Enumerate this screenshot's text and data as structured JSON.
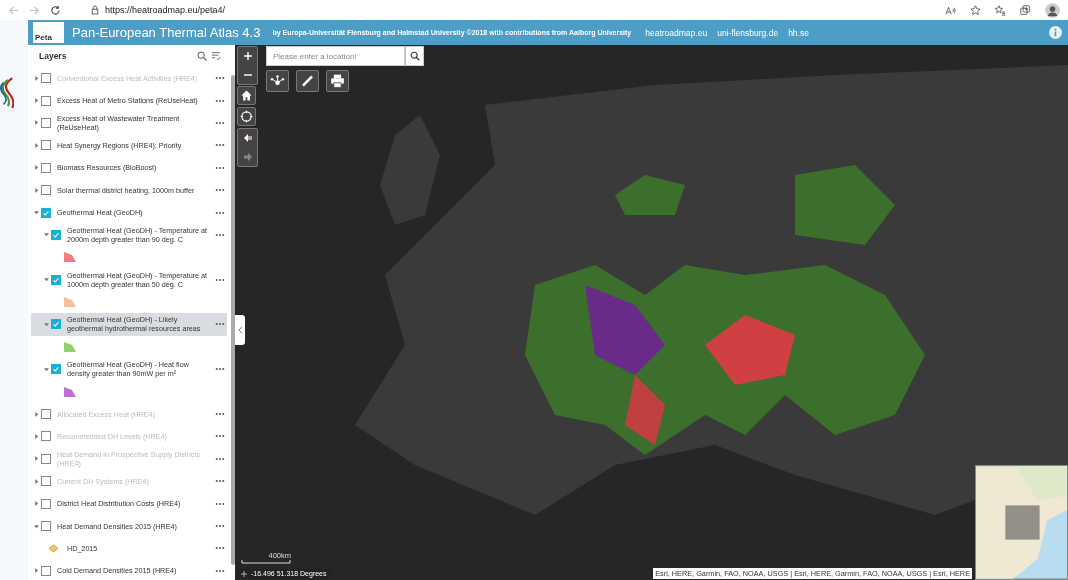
{
  "browser": {
    "url": "https://heatroadmap.eu/peta4/"
  },
  "header": {
    "logo_text": "Peta",
    "title": "Pan-European Thermal Atlas 4.3",
    "byline": "by Europa-Universität Flensburg and Halmstad University ©2018 with contributions from Aalborg University",
    "links": [
      "heatroadmap.eu",
      "uni-flensburg.de",
      "hh.se"
    ]
  },
  "sidebar": {
    "title": "Layers",
    "layers": [
      {
        "kind": "layer",
        "label": "Conventional Excess Heat Activities (HRE4)",
        "checked": false,
        "expanded": false,
        "disabled": true,
        "selected": false
      },
      {
        "kind": "layer",
        "label": "Excess Heat of Metro Stations (ReUseHeat)",
        "checked": false,
        "expanded": false,
        "disabled": false,
        "selected": false
      },
      {
        "kind": "layer",
        "label": "Excess Heat of Wastewater Treatment (ReUseHeat)",
        "checked": false,
        "expanded": false,
        "disabled": false,
        "selected": false
      },
      {
        "kind": "layer",
        "label": "Heat Synergy Regions (HRE4): Priority",
        "checked": false,
        "expanded": false,
        "disabled": false,
        "selected": false
      },
      {
        "kind": "layer",
        "label": "Biomass Resources (BioBoost)",
        "checked": false,
        "expanded": false,
        "disabled": false,
        "selected": false
      },
      {
        "kind": "layer",
        "label": "Solar thermal district heating, 1000m buffer",
        "checked": false,
        "expanded": false,
        "disabled": false,
        "selected": false
      },
      {
        "kind": "layer",
        "label": "Geothermal Heat (GeoDH)",
        "checked": true,
        "expanded": true,
        "disabled": false,
        "selected": false,
        "children": [
          {
            "kind": "layer",
            "label": "Geothermal Heat (GeoDH) - Temperature at 2000m depth greater than 90 deg. C",
            "checked": true,
            "expanded": true,
            "disabled": false,
            "selected": false,
            "children": [
              {
                "kind": "swatch",
                "color": "#f47c7c"
              }
            ]
          },
          {
            "kind": "layer",
            "label": "Geothermal Heat (GeoDH) - Temperature at 1000m depth greater than 50 deg. C",
            "checked": true,
            "expanded": true,
            "disabled": false,
            "selected": false,
            "children": [
              {
                "kind": "swatch",
                "color": "#f4c09c"
              }
            ]
          },
          {
            "kind": "layer",
            "label": "Geothermal Heat (GeoDH) - Likely geothermal hydrothermal resources areas",
            "checked": true,
            "expanded": true,
            "disabled": false,
            "selected": true,
            "children": [
              {
                "kind": "swatch",
                "color": "#90d070"
              }
            ]
          },
          {
            "kind": "layer",
            "label": "Geothermal Heat (GeoDH) - Heat flow density greater than 90mW per m²",
            "checked": true,
            "expanded": true,
            "disabled": false,
            "selected": false,
            "children": [
              {
                "kind": "swatch",
                "color": "#c070d0"
              }
            ]
          }
        ]
      },
      {
        "kind": "layer",
        "label": "Allocated Excess Heat (HRE4)",
        "checked": false,
        "expanded": false,
        "disabled": true,
        "selected": false
      },
      {
        "kind": "layer",
        "label": "Recommended DH Levels (HRE4)",
        "checked": false,
        "expanded": false,
        "disabled": true,
        "selected": false
      },
      {
        "kind": "layer",
        "label": "Heat Demand in Prospective Supply Districts (HRE4)",
        "checked": false,
        "expanded": false,
        "disabled": true,
        "selected": false
      },
      {
        "kind": "layer",
        "label": "Current DH Systems (HRE4)",
        "checked": false,
        "expanded": false,
        "disabled": true,
        "selected": false
      },
      {
        "kind": "layer",
        "label": "District Heat Distribution Costs (HRE4)",
        "checked": false,
        "expanded": false,
        "disabled": false,
        "selected": false
      },
      {
        "kind": "layer",
        "label": "Heat Demand Densities 2015 (HRE4)",
        "checked": false,
        "expanded": true,
        "disabled": false,
        "selected": false,
        "children": [
          {
            "kind": "symbol",
            "label": "HD_2015"
          }
        ]
      },
      {
        "kind": "layer",
        "label": "Cold Demand Densities 2015 (HRE4)",
        "checked": false,
        "expanded": false,
        "disabled": false,
        "selected": false
      }
    ]
  },
  "map": {
    "search": {
      "placeholder": "Please enter a location!"
    },
    "scale": "400km",
    "coordinates": "-16.496 51.318 Degrees",
    "attribution": "Esri, HERE, Garmin, FAO, NOAA, USGS | Esri, HERE, Garmin, FAO, NOAA, USGS | Esri, HERE"
  }
}
